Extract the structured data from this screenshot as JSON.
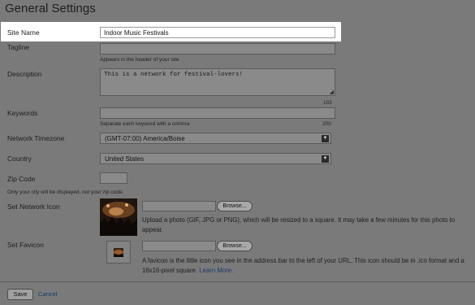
{
  "title": "General Settings",
  "site_name": {
    "label": "Site Name",
    "value": "Indoor Music Festivals"
  },
  "tagline": {
    "label": "Tagline",
    "value": "",
    "help": "Appears in the header of your site"
  },
  "description": {
    "label": "Description",
    "value": "This is a network for festival-lovers!",
    "count": "102"
  },
  "keywords": {
    "label": "Keywords",
    "value": "",
    "help": "Separate each keyword with a comma",
    "count": "200"
  },
  "timezone": {
    "label": "Network Timezone",
    "value": "(GMT-07:00) America/Boise"
  },
  "country": {
    "label": "Country",
    "value": "United States"
  },
  "zip": {
    "label": "Zip Code",
    "value": "",
    "help": "Only your city will be displayed, not your zip code."
  },
  "network_icon": {
    "label": "Set Network Icon",
    "browse": "Browse...",
    "help": "Upload a photo (GIF, JPG or PNG), which will be resized to a square. It may take a few minutes for this photo to appear."
  },
  "favicon": {
    "label": "Set Favicon",
    "browse": "Browse...",
    "help": "A favicon is the little icon you see in the address bar to the left of your URL. This icon should be in .ico format and a 16x16-pixel square.",
    "link": "Learn More."
  },
  "actions": {
    "save": "Save",
    "cancel": "Cancel"
  }
}
